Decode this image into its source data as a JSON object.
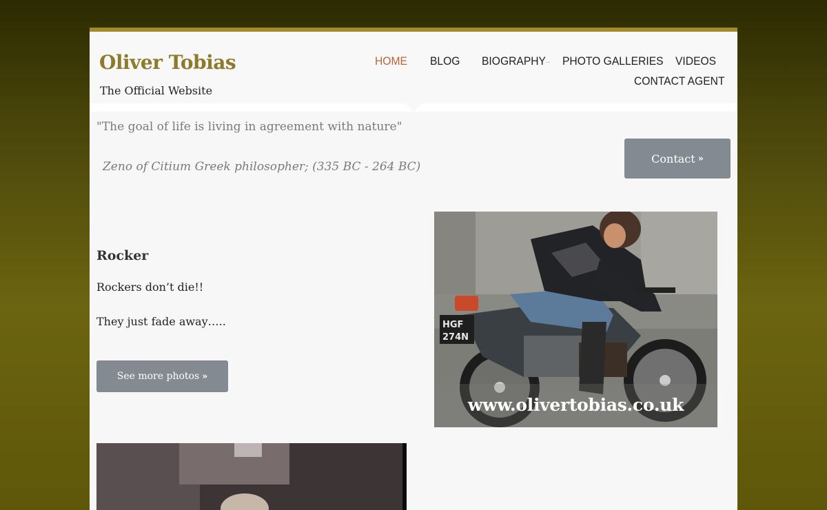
{
  "site": {
    "title": "Oliver Tobias",
    "subtitle": "The Official Website"
  },
  "nav": {
    "items": [
      {
        "label": "HOME",
        "active": true
      },
      {
        "label": "BLOG",
        "active": false
      },
      {
        "label": "BIOGRAPHY",
        "active": false
      },
      {
        "label": "PHOTO GALLERIES",
        "active": false
      },
      {
        "label": "VIDEOS",
        "active": false
      },
      {
        "label": "CONTACT AGENT",
        "active": false
      }
    ],
    "active_color": "#b5643a",
    "submenu_arrow_icon": "arrow-right-icon"
  },
  "quote": {
    "text": "\"The goal of life is living in agreement with nature\"",
    "author": "Zeno of Citium Greek philosopher; (335 BC - 264 BC)"
  },
  "contact_button": {
    "label": "Contact",
    "icon": "double-chevron-right-icon"
  },
  "section": {
    "title": "Rocker",
    "paragraphs": [
      "Rockers don’t die!!",
      "They just fade away….."
    ],
    "button_label": "See more photos",
    "button_icon": "double-chevron-right-icon"
  },
  "photo": {
    "watermark": "www.olivertobias.co.uk",
    "plate": "HGF 274N"
  },
  "colors": {
    "accent_bar": "#a58a2b",
    "title": "#8d7a2a",
    "button_bg": "#848a91"
  }
}
